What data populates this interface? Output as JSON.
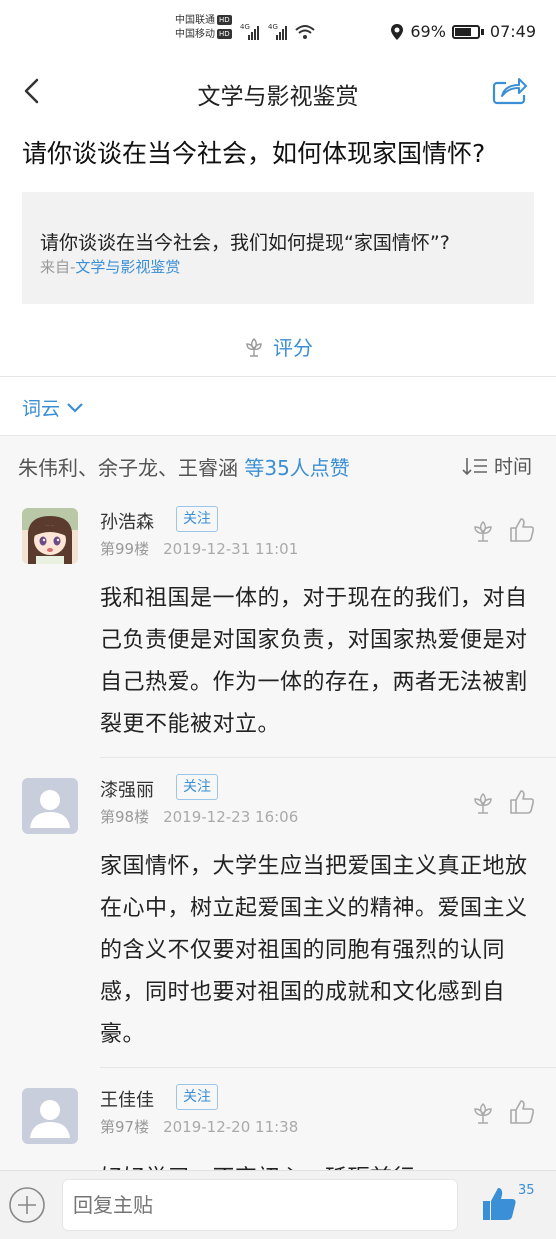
{
  "status": {
    "carrier1": "中国联通",
    "carrier2": "中国移动",
    "hd": "HD",
    "net": "4G",
    "battery": "69%",
    "time": "07:49"
  },
  "nav": {
    "title": "文学与影视鉴赏"
  },
  "question": {
    "title": "请你谈谈在当今社会，如何体现家国情怀?",
    "detail": "请你谈谈在当今社会，我们如何提现“家国情怀”?",
    "source_prefix": "来自-",
    "source_link": "文学与影视鉴赏",
    "rate_label": "评分"
  },
  "wordcloud": {
    "label": "词云"
  },
  "likes": {
    "names": "朱伟利、余子龙、王睿涵 ",
    "count_text": "等35人点赞",
    "sort_label": "时间"
  },
  "posts": [
    {
      "name": "孙浩森",
      "follow": "关注",
      "floor": "第99楼",
      "time": "2019-12-31 11:01",
      "content": "我和祖国是一体的，对于现在的我们，对自己负责便是对国家负责，对国家热爱便是对自己热爱。作为一体的存在，两者无法被割裂更不能被对立。"
    },
    {
      "name": "漆强丽",
      "follow": "关注",
      "floor": "第98楼",
      "time": "2019-12-23 16:06",
      "content": "家国情怀，大学生应当把爱国主义真正地放在心中，树立起爱国主义的精神。爱国主义的含义不仅要对祖国的同胞有强烈的认同感，同时也要对祖国的成就和文化感到自豪。"
    },
    {
      "name": "王佳佳",
      "follow": "关注",
      "floor": "第97楼",
      "time": "2019-12-20 11:38",
      "content": "好好学习，不忘初心，砥砺前行"
    }
  ],
  "reply": {
    "placeholder": "回复主贴",
    "like_count": "35"
  },
  "colors": {
    "accent": "#3a8fd6",
    "background": "#f7f7f7"
  }
}
